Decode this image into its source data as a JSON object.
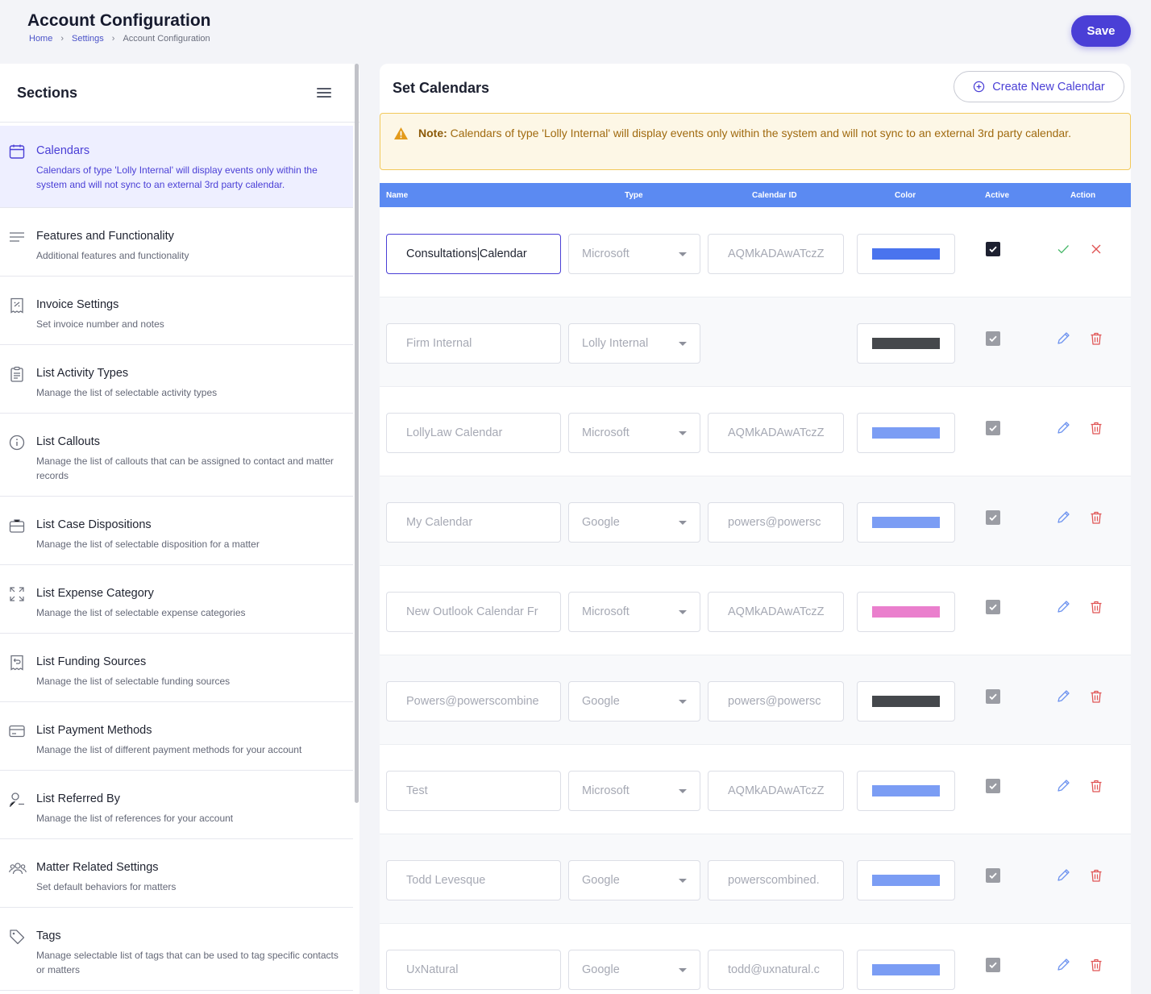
{
  "header": {
    "title": "Account Configuration",
    "breadcrumb": [
      "Home",
      "Settings",
      "Account Configuration"
    ],
    "save_label": "Save"
  },
  "sidebar": {
    "title": "Sections",
    "items": [
      {
        "title": "Calendars",
        "desc": "Calendars of type 'Lolly Internal' will display events only within the system and will not sync to an external 3rd party calendar.",
        "icon": "calendar-icon",
        "active": true
      },
      {
        "title": "Features and Functionality",
        "desc": "Additional features and functionality",
        "icon": "lines-icon"
      },
      {
        "title": "Invoice Settings",
        "desc": "Set invoice number and notes",
        "icon": "receipt-icon"
      },
      {
        "title": "List Activity Types",
        "desc": "Manage the list of selectable activity types",
        "icon": "clipboard-icon"
      },
      {
        "title": "List Callouts",
        "desc": "Manage the list of callouts that can be assigned to contact and matter records",
        "icon": "info-icon"
      },
      {
        "title": "List Case Dispositions",
        "desc": "Manage the list of selectable disposition for a matter",
        "icon": "briefcase-icon"
      },
      {
        "title": "List Expense Category",
        "desc": "Manage the list of selectable expense categories",
        "icon": "expand-icon"
      },
      {
        "title": "List Funding Sources",
        "desc": "Manage the list of selectable funding sources",
        "icon": "refund-receipt-icon"
      },
      {
        "title": "List Payment Methods",
        "desc": "Manage the list of different payment methods for your account",
        "icon": "credit-card-icon"
      },
      {
        "title": "List Referred By",
        "desc": "Manage the list of references for your account",
        "icon": "user-icon"
      },
      {
        "title": "Matter Related Settings",
        "desc": "Set default behaviors for matters",
        "icon": "group-icon"
      },
      {
        "title": "Tags",
        "desc": "Manage selectable list of tags that can be used to tag specific contacts or matters",
        "icon": "tag-icon"
      }
    ]
  },
  "main": {
    "title": "Set Calendars",
    "create_label": "Create New Calendar",
    "note_label": "Note:",
    "note_text": "Calendars of type 'Lolly Internal' will display events only within the system and will not sync to an external 3rd party calendar.",
    "columns": [
      "Name",
      "Type",
      "Calendar ID",
      "Color",
      "Active",
      "Action"
    ],
    "rows": [
      {
        "name_a": "Consultations",
        "name_b": "Calendar",
        "type": "Microsoft",
        "id": "AQMkADAwATczZ",
        "color": "#4a74ee",
        "active": true,
        "editing": true
      },
      {
        "name": "Firm Internal",
        "type": "Lolly Internal",
        "id": "",
        "color": "#45484c",
        "active": true
      },
      {
        "name": "LollyLaw Calendar",
        "type": "Microsoft",
        "id": "AQMkADAwATczZ",
        "color": "#7b9df4",
        "active": true
      },
      {
        "name": "My Calendar",
        "type": "Google",
        "id": "powers@powersc",
        "color": "#7b9df4",
        "active": true
      },
      {
        "name": "New Outlook Calendar Fr",
        "type": "Microsoft",
        "id": "AQMkADAwATczZ",
        "color": "#ea7fcd",
        "active": true
      },
      {
        "name": "Powers@powerscombine",
        "type": "Google",
        "id": "powers@powersc",
        "color": "#45484c",
        "active": true
      },
      {
        "name": "Test",
        "type": "Microsoft",
        "id": "AQMkADAwATczZ",
        "color": "#7b9df4",
        "active": true
      },
      {
        "name": "Todd Levesque",
        "type": "Google",
        "id": "powerscombined.",
        "color": "#7b9df4",
        "active": true
      },
      {
        "name": "UxNatural",
        "type": "Google",
        "id": "todd@uxnatural.c",
        "color": "#7b9df4",
        "active": true
      }
    ]
  },
  "colors": {
    "accent": "#4a3fd6",
    "table_header": "#5b8af2",
    "note_border": "#f2c95b",
    "delete": "#e05555",
    "confirm": "#49b86a"
  }
}
